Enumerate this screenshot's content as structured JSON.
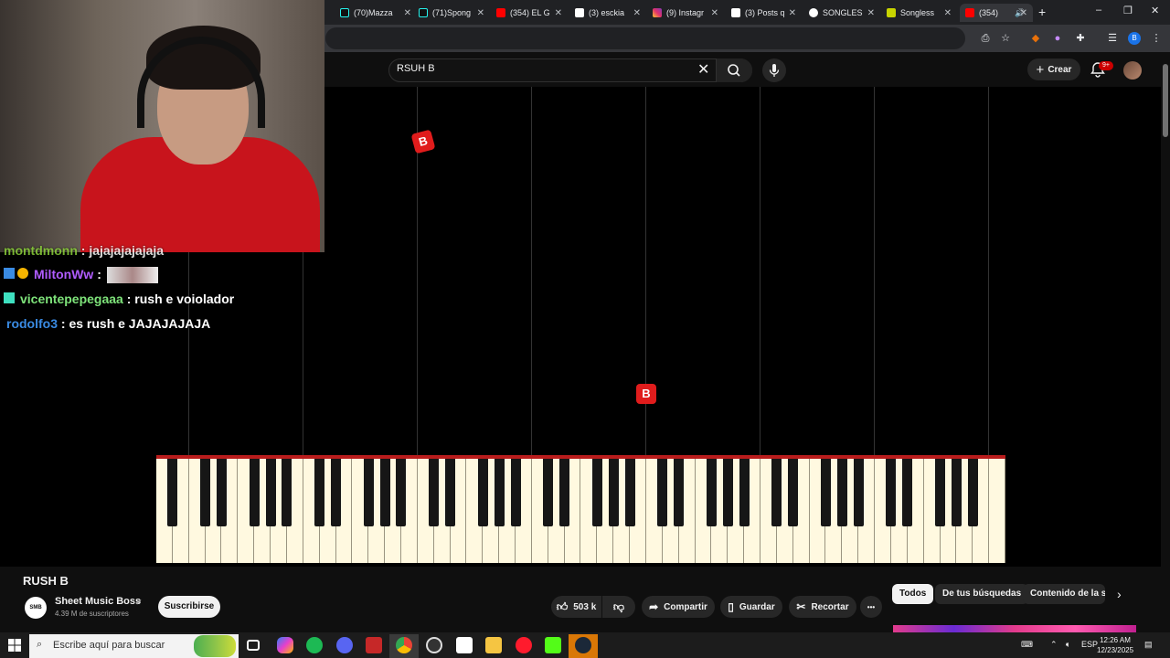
{
  "browser": {
    "tabs": [
      {
        "label": "(70)Mazza",
        "icon": "tiktok-icon"
      },
      {
        "label": "(71)Spong",
        "icon": "tiktok-icon"
      },
      {
        "label": "(354) EL G",
        "icon": "youtube-icon"
      },
      {
        "label": "(3) esckia",
        "icon": "x-icon"
      },
      {
        "label": "(9) Instagr",
        "icon": "instagram-icon"
      },
      {
        "label": "(3) Posts q",
        "icon": "x-icon"
      },
      {
        "label": "SONGLES",
        "icon": "google-icon"
      },
      {
        "label": "Songless",
        "icon": "songless-icon"
      },
      {
        "label": "(354)",
        "icon": "youtube-icon"
      }
    ],
    "new_tab": "+",
    "window_controls": [
      "–",
      "❐",
      "✕"
    ]
  },
  "youtube": {
    "search_value": "RSUH B",
    "create_label": "Crear",
    "notif_badge": "9+"
  },
  "video": {
    "notes": [
      {
        "label": "B"
      },
      {
        "label": "B"
      }
    ]
  },
  "chat": [
    {
      "user": "montdmonn",
      "user_color": "#8bd13a",
      "message": " : jajajajajajaja"
    },
    {
      "user": "MiltonWw",
      "user_color": "#b05cff",
      "message": " :"
    },
    {
      "user": "vicentepepegaaa",
      "user_color": "#7ee37a",
      "message": " : rush e voiolador"
    },
    {
      "user": "rodolfo3",
      "user_color": "#3a8be3",
      "message": " : es rush e JAJAJAJAJA"
    }
  ],
  "video_info": {
    "title": "RUSH B",
    "channel_name": "Sheet Music Boss",
    "channel_avatar_text": "SMB",
    "subscribers": "4.39 M de suscriptores",
    "subscribe_label": "Suscribirse",
    "likes": "503 k",
    "share_label": "Compartir",
    "save_label": "Guardar",
    "clip_label": "Recortar",
    "more_label": "•••"
  },
  "chips": [
    {
      "label": "Todos",
      "active": true
    },
    {
      "label": "De tus búsquedas",
      "active": false
    },
    {
      "label": "Contenido de la ser",
      "active": false
    }
  ],
  "taskbar": {
    "search_placeholder": "Escribe aquí para buscar",
    "language": "ESP",
    "time": "12:26 AM",
    "date": "12/23/2025"
  }
}
